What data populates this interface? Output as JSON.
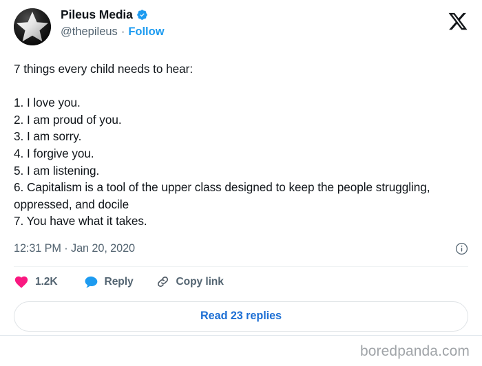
{
  "card": {
    "platform_logo": "x-logo",
    "author": {
      "display_name": "Pileus Media",
      "verified": true,
      "verified_icon": "verified-badge-icon",
      "handle": "@thepileus",
      "separator": "·",
      "follow_label": "Follow",
      "avatar_icon": "star-avatar"
    },
    "body_text": "7 things every child needs to hear:\n\n1. I love you.\n2. I am proud of you.\n3. I am sorry.\n4. I forgive you.\n5. I am listening.\n6. Capitalism is a tool of the upper class designed to keep the people struggling, oppressed, and docile\n7. You have what it takes.",
    "timestamp": "12:31 PM · Jan 20, 2020",
    "info_icon": "info-circle-icon",
    "actions": {
      "like": {
        "icon": "heart-icon",
        "count": "1.2K"
      },
      "reply": {
        "icon": "comment-bubble-icon",
        "label": "Reply"
      },
      "copy_link": {
        "icon": "link-chain-icon",
        "label": "Copy link"
      }
    },
    "read_replies_label": "Read 23 replies"
  },
  "watermark": "boredpanda.com",
  "colors": {
    "twitter_blue": "#1d9bf0",
    "link_blue": "#1d6fd4",
    "like_pink": "#f91880",
    "text_primary": "#0f1419",
    "text_secondary": "#536471",
    "border": "#e1e8ed",
    "watermark_gray": "#a0a4a8"
  }
}
